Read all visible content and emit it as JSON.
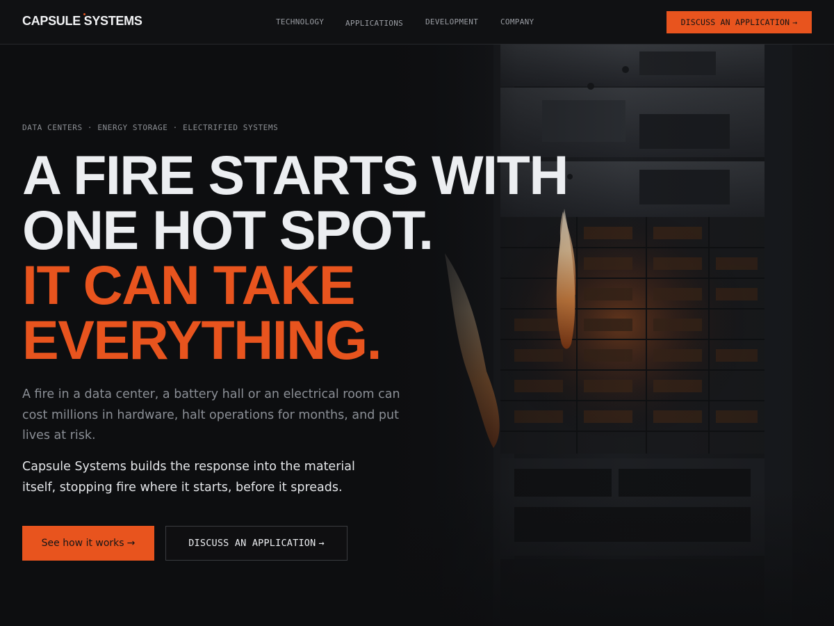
{
  "brand": {
    "name": "CAPSULE SYSTEMS",
    "accent": "#e8541e"
  },
  "nav": {
    "items": [
      {
        "label": "TECHNOLOGY"
      },
      {
        "label": "APPLICATIONS"
      },
      {
        "label": "DEVELOPMENT"
      },
      {
        "label": "COMPANY"
      }
    ],
    "cta_label": "DISCUSS AN APPLICATION",
    "cta_icon": "arrow-right-icon"
  },
  "hero": {
    "eyebrow": "DATA CENTERS · ENERGY STORAGE · ELECTRIFIED SYSTEMS",
    "headline": {
      "line1": "A FIRE STARTS WITH",
      "line2": "ONE HOT SPOT.",
      "line3": "IT CAN TAKE",
      "line4": "EVERYTHING."
    },
    "description": "A fire in a data center, a battery hall or an electrical room can cost millions in hardware, halt operations for months, and put lives at risk.",
    "description_2": "Capsule Systems builds the response into the material itself, stopping fire where it starts, before it spreads.",
    "primary_button": "See how it works",
    "secondary_button": "DISCUSS AN APPLICATION",
    "button_icon": "arrow-right-icon",
    "image": "server-rack-fire-image"
  },
  "colors": {
    "background": "#0d0e10",
    "headline_white": "#eceef1",
    "headline_accent": "#e8541e",
    "muted_text": "#8b8f96"
  }
}
